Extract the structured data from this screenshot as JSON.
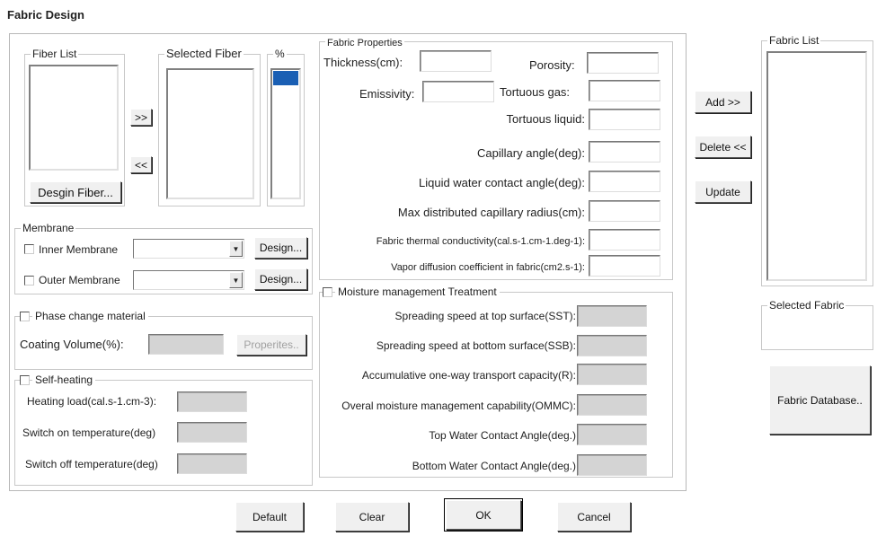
{
  "window": {
    "title": "Fabric Design"
  },
  "fiber": {
    "fiber_list_label": "Fiber List",
    "selected_fiber_label": "Selected Fiber",
    "percent_label": "%",
    "add_arrow": ">>",
    "remove_arrow": "<<",
    "design_fiber_button": "Desgin Fiber..."
  },
  "membrane": {
    "legend": "Membrane",
    "inner_label": "Inner Membrane",
    "outer_label": "Outer Membrane",
    "design_button": "Design..."
  },
  "phase_change": {
    "legend": "Phase change material",
    "coating_label": "Coating Volume(%):",
    "properties_button": "Properites.."
  },
  "self_heating": {
    "legend": "Self-heating",
    "heating_load_label": "Heating load(cal.s-1.cm-3):",
    "switch_on_label": "Switch on temperature(deg)",
    "switch_off_label": "Switch off temperature(deg)"
  },
  "fabric_properties": {
    "legend": "Fabric Properties",
    "thickness": "Thickness(cm):",
    "porosity": "Porosity:",
    "emissivity": "Emissivity:",
    "tortuous_gas": "Tortuous gas:",
    "tortuous_liquid": "Tortuous liquid:",
    "capillary_angle": "Capillary angle(deg):",
    "liquid_contact_angle": "Liquid water contact angle(deg):",
    "max_capillary_radius": "Max distributed capillary radius(cm):",
    "thermal_conductivity": "Fabric thermal conductivity(cal.s-1.cm-1.deg-1):",
    "vapor_diffusion": "Vapor diffusion coefficient in fabric(cm2.s-1):"
  },
  "moisture": {
    "legend": "Moisture management Treatment",
    "sst": "Spreading speed at top surface(SST):",
    "ssb": "Spreading speed at bottom surface(SSB):",
    "r": "Accumulative one-way transport capacity(R):",
    "ommc": "Overal moisture management capability(OMMC):",
    "top_angle": "Top Water Contact Angle(deg.)",
    "bottom_angle": "Bottom Water Contact Angle(deg.)"
  },
  "side_buttons": {
    "add": "Add >>",
    "delete": "Delete <<",
    "update": "Update"
  },
  "fabric_list": {
    "legend": "Fabric List"
  },
  "selected_fabric": {
    "legend": "Selected Fabric"
  },
  "fabric_database_button": "Fabric Database..",
  "bottom_buttons": {
    "default": "Default",
    "clear": "Clear",
    "ok": "OK",
    "cancel": "Cancel"
  },
  "colors": {
    "selection": "#1a5fb4",
    "disabled_field": "#d4d4d4"
  }
}
